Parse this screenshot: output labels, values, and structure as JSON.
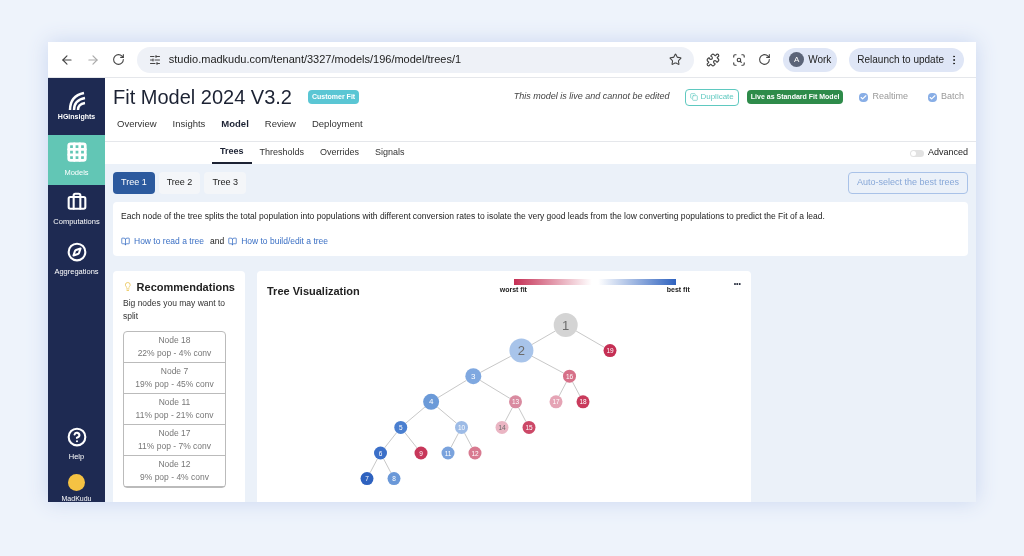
{
  "browser": {
    "url": "studio.madkudu.com/tenant/3327/models/196/model/trees/1",
    "profile_avatar": "A",
    "profile": "Work",
    "relaunch": "Relaunch to update"
  },
  "sidebar": {
    "logo": "HGinsights",
    "items": [
      {
        "label": "Models",
        "kind": "grid",
        "selected": true
      },
      {
        "label": "Computations",
        "kind": "toolbox",
        "selected": false
      },
      {
        "label": "Aggregations",
        "kind": "compass",
        "selected": false
      }
    ],
    "help": "Help",
    "user": "MadKudu"
  },
  "header": {
    "title": "Fit Model 2024 V3.2",
    "badge": "Customer Fit",
    "notice": "This model is live and cannot be edited",
    "duplicate": "Duplicate",
    "live_badge": "Live as Standard Fit Model",
    "checks": [
      {
        "label": "Realtime",
        "checked": true
      },
      {
        "label": "Batch",
        "checked": true
      }
    ]
  },
  "nav": [
    {
      "label": "Overview",
      "selected": false
    },
    {
      "label": "Insights",
      "selected": false
    },
    {
      "label": "Model",
      "selected": true
    },
    {
      "label": "Review",
      "selected": false
    },
    {
      "label": "Deployment",
      "selected": false
    }
  ],
  "subnav": [
    {
      "label": "Trees",
      "selected": true
    },
    {
      "label": "Thresholds",
      "selected": false
    },
    {
      "label": "Overrides",
      "selected": false
    },
    {
      "label": "Signals",
      "selected": false
    }
  ],
  "advanced": {
    "label": "Advanced",
    "on": false
  },
  "tree_tabs": [
    {
      "label": "Tree 1",
      "selected": true
    },
    {
      "label": "Tree 2",
      "selected": false
    },
    {
      "label": "Tree 3",
      "selected": false
    }
  ],
  "auto_select": "Auto-select the best trees",
  "info": {
    "text": "Each node of the tree splits the total population into populations with different conversion rates to isolate the very good leads from the low converting populations to predict the Fit of a lead.",
    "link1": "How to read a tree",
    "joiner": "and",
    "link2": "How to build/edit a tree"
  },
  "recommendations": {
    "title": "Recommendations",
    "subtitle": "Big nodes you may want to split",
    "nodes": [
      {
        "name": "Node 18",
        "stats": "22% pop - 4% conv"
      },
      {
        "name": "Node 7",
        "stats": "19% pop - 45% conv"
      },
      {
        "name": "Node 11",
        "stats": "11% pop - 21% conv"
      },
      {
        "name": "Node 17",
        "stats": "11% pop - 7% conv"
      },
      {
        "name": "Node 12",
        "stats": "9% pop - 4% conv"
      }
    ]
  },
  "tree": {
    "title": "Tree Visualization",
    "legend_low": "worst fit",
    "legend_high": "best fit",
    "more": "•••",
    "root": {
      "label": "1",
      "kind": "large",
      "color": "#d4d4d4",
      "children": [
        {
          "label": "2",
          "kind": "large",
          "color": "#a8c4ea",
          "children": [
            {
              "label": "3",
              "kind": "medium",
              "color": "#7fa8e0",
              "children": [
                {
                  "label": "4",
                  "kind": "medium",
                  "color": "#6b9ad8",
                  "children": [
                    {
                      "label": "5",
                      "kind": "small",
                      "color": "#4a7fd0",
                      "children": [
                        {
                          "label": "6",
                          "kind": "small",
                          "color": "#3b6fc8",
                          "children": [
                            {
                              "label": "7",
                              "kind": "small",
                              "color": "#2e62bf"
                            },
                            {
                              "label": "8",
                              "kind": "small",
                              "color": "#6a98d8"
                            }
                          ]
                        },
                        {
                          "label": "9",
                          "kind": "small",
                          "color": "#c7375a"
                        }
                      ]
                    },
                    {
                      "label": "10",
                      "kind": "small",
                      "color": "#9dbbe6",
                      "children": [
                        {
                          "label": "11",
                          "kind": "small",
                          "color": "#7aa3dd"
                        },
                        {
                          "label": "12",
                          "kind": "small",
                          "color": "#d87a90"
                        }
                      ]
                    }
                  ]
                },
                {
                  "label": "13",
                  "kind": "small",
                  "color": "#d98ba0",
                  "children": [
                    {
                      "label": "14",
                      "kind": "small",
                      "color": "#eab5c3"
                    },
                    {
                      "label": "15",
                      "kind": "small",
                      "color": "#cc4867"
                    }
                  ]
                }
              ]
            },
            {
              "label": "16",
              "kind": "small",
              "color": "#d67088",
              "children": [
                {
                  "label": "17",
                  "kind": "small",
                  "color": "#e5a4b5"
                },
                {
                  "label": "18",
                  "kind": "small",
                  "color": "#c93b5c"
                }
              ]
            }
          ]
        },
        {
          "label": "19",
          "kind": "small",
          "color": "#c52f54"
        }
      ]
    }
  }
}
